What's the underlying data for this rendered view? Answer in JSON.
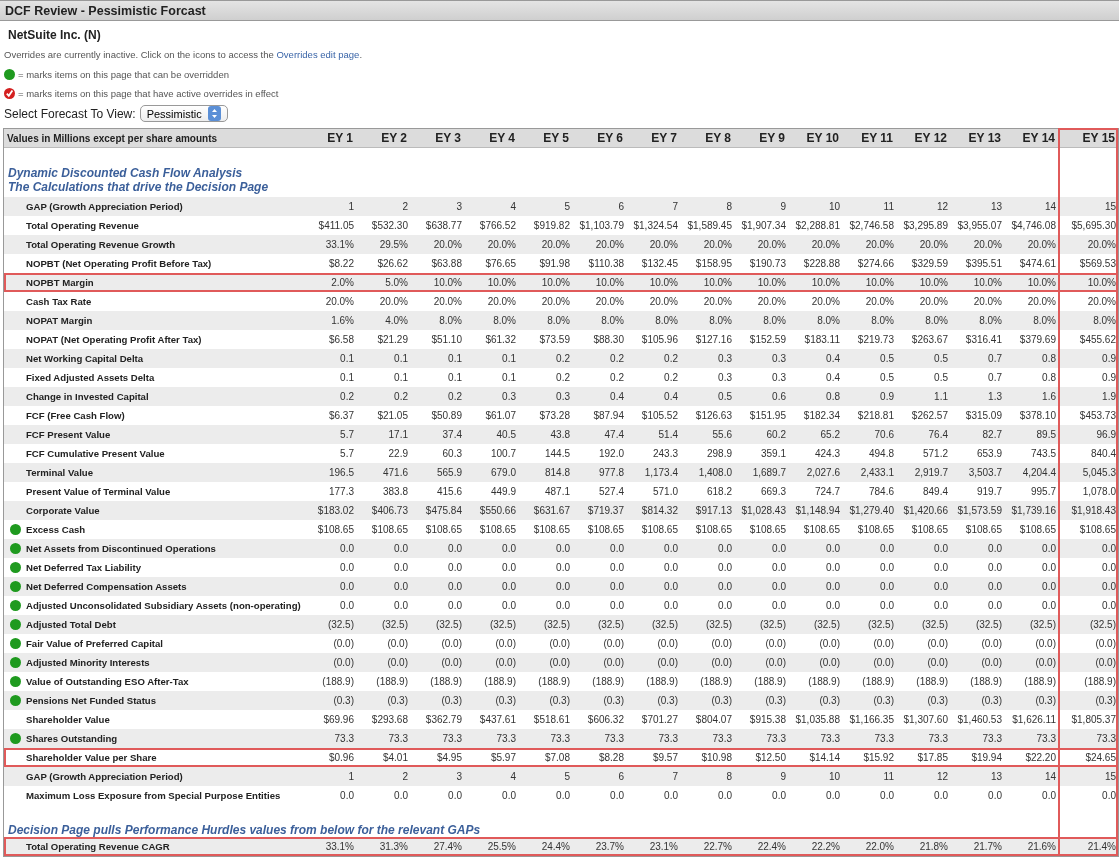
{
  "window": {
    "title": "DCF Review - Pessimistic Forcast"
  },
  "company": "NetSuite Inc. (N)",
  "intro": {
    "text": "Overrides are currently inactive. Click on the icons to access the",
    "link": "Overrides edit page",
    "after": "."
  },
  "legend": [
    {
      "kind": "overridable",
      "text": "= marks items on this page that can be overridden"
    },
    {
      "kind": "active",
      "text": "= marks items on this page that have active overrides in effect"
    }
  ],
  "forecast_select": {
    "label": "Select Forecast To View:",
    "value": "Pessimistic"
  },
  "table": {
    "caption": "Values in Millions except per share amounts",
    "columns": [
      {
        "label": "EY 1",
        "highlighted": false
      },
      {
        "label": "EY 2",
        "highlighted": false
      },
      {
        "label": "EY 3",
        "highlighted": false
      },
      {
        "label": "EY 4",
        "highlighted": false
      },
      {
        "label": "EY 5",
        "highlighted": false
      },
      {
        "label": "EY 6",
        "highlighted": false
      },
      {
        "label": "EY 7",
        "highlighted": false
      },
      {
        "label": "EY 8",
        "highlighted": false
      },
      {
        "label": "EY 9",
        "highlighted": false
      },
      {
        "label": "EY 10",
        "highlighted": false
      },
      {
        "label": "EY 11",
        "highlighted": false
      },
      {
        "label": "EY 12",
        "highlighted": false
      },
      {
        "label": "EY 13",
        "highlighted": false
      },
      {
        "label": "EY 14",
        "highlighted": false
      },
      {
        "label": "EY 15",
        "highlighted": true
      }
    ],
    "section_headings": [
      "Dynamic Discounted Cash Flow Analysis",
      "The Calculations that drive the Decision Page"
    ],
    "rows": [
      {
        "label": "GAP (Growth Appreciation Period)",
        "overridable": false,
        "highlighted": false,
        "values": [
          "1",
          "2",
          "3",
          "4",
          "5",
          "6",
          "7",
          "8",
          "9",
          "10",
          "11",
          "12",
          "13",
          "14",
          "15"
        ]
      },
      {
        "label": "Total Operating Revenue",
        "overridable": false,
        "highlighted": false,
        "values": [
          "$411.05",
          "$532.30",
          "$638.77",
          "$766.52",
          "$919.82",
          "$1,103.79",
          "$1,324.54",
          "$1,589.45",
          "$1,907.34",
          "$2,288.81",
          "$2,746.58",
          "$3,295.89",
          "$3,955.07",
          "$4,746.08",
          "$5,695.30"
        ]
      },
      {
        "label": "Total Operating Revenue Growth",
        "overridable": false,
        "highlighted": false,
        "values": [
          "33.1%",
          "29.5%",
          "20.0%",
          "20.0%",
          "20.0%",
          "20.0%",
          "20.0%",
          "20.0%",
          "20.0%",
          "20.0%",
          "20.0%",
          "20.0%",
          "20.0%",
          "20.0%",
          "20.0%"
        ]
      },
      {
        "label": "NOPBT (Net Operating Profit Before Tax)",
        "overridable": false,
        "highlighted": false,
        "values": [
          "$8.22",
          "$26.62",
          "$63.88",
          "$76.65",
          "$91.98",
          "$110.38",
          "$132.45",
          "$158.95",
          "$190.73",
          "$228.88",
          "$274.66",
          "$329.59",
          "$395.51",
          "$474.61",
          "$569.53"
        ]
      },
      {
        "label": "NOPBT Margin",
        "overridable": false,
        "highlighted": true,
        "values": [
          "2.0%",
          "5.0%",
          "10.0%",
          "10.0%",
          "10.0%",
          "10.0%",
          "10.0%",
          "10.0%",
          "10.0%",
          "10.0%",
          "10.0%",
          "10.0%",
          "10.0%",
          "10.0%",
          "10.0%"
        ]
      },
      {
        "label": "Cash Tax Rate",
        "overridable": false,
        "highlighted": false,
        "values": [
          "20.0%",
          "20.0%",
          "20.0%",
          "20.0%",
          "20.0%",
          "20.0%",
          "20.0%",
          "20.0%",
          "20.0%",
          "20.0%",
          "20.0%",
          "20.0%",
          "20.0%",
          "20.0%",
          "20.0%"
        ]
      },
      {
        "label": "NOPAT Margin",
        "overridable": false,
        "highlighted": false,
        "values": [
          "1.6%",
          "4.0%",
          "8.0%",
          "8.0%",
          "8.0%",
          "8.0%",
          "8.0%",
          "8.0%",
          "8.0%",
          "8.0%",
          "8.0%",
          "8.0%",
          "8.0%",
          "8.0%",
          "8.0%"
        ]
      },
      {
        "label": "NOPAT (Net Operating Profit After Tax)",
        "overridable": false,
        "highlighted": false,
        "values": [
          "$6.58",
          "$21.29",
          "$51.10",
          "$61.32",
          "$73.59",
          "$88.30",
          "$105.96",
          "$127.16",
          "$152.59",
          "$183.11",
          "$219.73",
          "$263.67",
          "$316.41",
          "$379.69",
          "$455.62"
        ]
      },
      {
        "label": "Net Working Capital Delta",
        "overridable": false,
        "highlighted": false,
        "values": [
          "0.1",
          "0.1",
          "0.1",
          "0.1",
          "0.2",
          "0.2",
          "0.2",
          "0.3",
          "0.3",
          "0.4",
          "0.5",
          "0.5",
          "0.7",
          "0.8",
          "0.9"
        ]
      },
      {
        "label": "Fixed Adjusted Assets Delta",
        "overridable": false,
        "highlighted": false,
        "values": [
          "0.1",
          "0.1",
          "0.1",
          "0.1",
          "0.2",
          "0.2",
          "0.2",
          "0.3",
          "0.3",
          "0.4",
          "0.5",
          "0.5",
          "0.7",
          "0.8",
          "0.9"
        ]
      },
      {
        "label": "Change in Invested Capital",
        "overridable": false,
        "highlighted": false,
        "values": [
          "0.2",
          "0.2",
          "0.2",
          "0.3",
          "0.3",
          "0.4",
          "0.4",
          "0.5",
          "0.6",
          "0.8",
          "0.9",
          "1.1",
          "1.3",
          "1.6",
          "1.9"
        ]
      },
      {
        "label": "FCF (Free Cash Flow)",
        "overridable": false,
        "highlighted": false,
        "values": [
          "$6.37",
          "$21.05",
          "$50.89",
          "$61.07",
          "$73.28",
          "$87.94",
          "$105.52",
          "$126.63",
          "$151.95",
          "$182.34",
          "$218.81",
          "$262.57",
          "$315.09",
          "$378.10",
          "$453.73"
        ]
      },
      {
        "label": "FCF Present Value",
        "overridable": false,
        "highlighted": false,
        "values": [
          "5.7",
          "17.1",
          "37.4",
          "40.5",
          "43.8",
          "47.4",
          "51.4",
          "55.6",
          "60.2",
          "65.2",
          "70.6",
          "76.4",
          "82.7",
          "89.5",
          "96.9"
        ]
      },
      {
        "label": "FCF Cumulative Present Value",
        "overridable": false,
        "highlighted": false,
        "values": [
          "5.7",
          "22.9",
          "60.3",
          "100.7",
          "144.5",
          "192.0",
          "243.3",
          "298.9",
          "359.1",
          "424.3",
          "494.8",
          "571.2",
          "653.9",
          "743.5",
          "840.4"
        ]
      },
      {
        "label": "Terminal Value",
        "overridable": false,
        "highlighted": false,
        "values": [
          "196.5",
          "471.6",
          "565.9",
          "679.0",
          "814.8",
          "977.8",
          "1,173.4",
          "1,408.0",
          "1,689.7",
          "2,027.6",
          "2,433.1",
          "2,919.7",
          "3,503.7",
          "4,204.4",
          "5,045.3"
        ]
      },
      {
        "label": "Present Value of Terminal Value",
        "overridable": false,
        "highlighted": false,
        "values": [
          "177.3",
          "383.8",
          "415.6",
          "449.9",
          "487.1",
          "527.4",
          "571.0",
          "618.2",
          "669.3",
          "724.7",
          "784.6",
          "849.4",
          "919.7",
          "995.7",
          "1,078.0"
        ]
      },
      {
        "label": "Corporate Value",
        "overridable": false,
        "highlighted": false,
        "values": [
          "$183.02",
          "$406.73",
          "$475.84",
          "$550.66",
          "$631.67",
          "$719.37",
          "$814.32",
          "$917.13",
          "$1,028.43",
          "$1,148.94",
          "$1,279.40",
          "$1,420.66",
          "$1,573.59",
          "$1,739.16",
          "$1,918.43"
        ]
      },
      {
        "label": "Excess Cash",
        "overridable": true,
        "highlighted": false,
        "values": [
          "$108.65",
          "$108.65",
          "$108.65",
          "$108.65",
          "$108.65",
          "$108.65",
          "$108.65",
          "$108.65",
          "$108.65",
          "$108.65",
          "$108.65",
          "$108.65",
          "$108.65",
          "$108.65",
          "$108.65"
        ]
      },
      {
        "label": "Net Assets from Discontinued Operations",
        "overridable": true,
        "highlighted": false,
        "values": [
          "0.0",
          "0.0",
          "0.0",
          "0.0",
          "0.0",
          "0.0",
          "0.0",
          "0.0",
          "0.0",
          "0.0",
          "0.0",
          "0.0",
          "0.0",
          "0.0",
          "0.0"
        ]
      },
      {
        "label": "Net Deferred Tax Liability",
        "overridable": true,
        "highlighted": false,
        "values": [
          "0.0",
          "0.0",
          "0.0",
          "0.0",
          "0.0",
          "0.0",
          "0.0",
          "0.0",
          "0.0",
          "0.0",
          "0.0",
          "0.0",
          "0.0",
          "0.0",
          "0.0"
        ]
      },
      {
        "label": "Net Deferred Compensation Assets",
        "overridable": true,
        "highlighted": false,
        "values": [
          "0.0",
          "0.0",
          "0.0",
          "0.0",
          "0.0",
          "0.0",
          "0.0",
          "0.0",
          "0.0",
          "0.0",
          "0.0",
          "0.0",
          "0.0",
          "0.0",
          "0.0"
        ]
      },
      {
        "label": "Adjusted Unconsolidated Subsidiary Assets (non-operating)",
        "overridable": true,
        "highlighted": false,
        "values": [
          "0.0",
          "0.0",
          "0.0",
          "0.0",
          "0.0",
          "0.0",
          "0.0",
          "0.0",
          "0.0",
          "0.0",
          "0.0",
          "0.0",
          "0.0",
          "0.0",
          "0.0"
        ]
      },
      {
        "label": "Adjusted Total Debt",
        "overridable": true,
        "highlighted": false,
        "values": [
          "(32.5)",
          "(32.5)",
          "(32.5)",
          "(32.5)",
          "(32.5)",
          "(32.5)",
          "(32.5)",
          "(32.5)",
          "(32.5)",
          "(32.5)",
          "(32.5)",
          "(32.5)",
          "(32.5)",
          "(32.5)",
          "(32.5)"
        ]
      },
      {
        "label": "Fair Value of Preferred Capital",
        "overridable": true,
        "highlighted": false,
        "values": [
          "(0.0)",
          "(0.0)",
          "(0.0)",
          "(0.0)",
          "(0.0)",
          "(0.0)",
          "(0.0)",
          "(0.0)",
          "(0.0)",
          "(0.0)",
          "(0.0)",
          "(0.0)",
          "(0.0)",
          "(0.0)",
          "(0.0)"
        ]
      },
      {
        "label": "Adjusted Minority Interests",
        "overridable": true,
        "highlighted": false,
        "values": [
          "(0.0)",
          "(0.0)",
          "(0.0)",
          "(0.0)",
          "(0.0)",
          "(0.0)",
          "(0.0)",
          "(0.0)",
          "(0.0)",
          "(0.0)",
          "(0.0)",
          "(0.0)",
          "(0.0)",
          "(0.0)",
          "(0.0)"
        ]
      },
      {
        "label": "Value of Outstanding ESO After-Tax",
        "overridable": true,
        "highlighted": false,
        "values": [
          "(188.9)",
          "(188.9)",
          "(188.9)",
          "(188.9)",
          "(188.9)",
          "(188.9)",
          "(188.9)",
          "(188.9)",
          "(188.9)",
          "(188.9)",
          "(188.9)",
          "(188.9)",
          "(188.9)",
          "(188.9)",
          "(188.9)"
        ]
      },
      {
        "label": "Pensions Net Funded Status",
        "overridable": true,
        "highlighted": false,
        "values": [
          "(0.3)",
          "(0.3)",
          "(0.3)",
          "(0.3)",
          "(0.3)",
          "(0.3)",
          "(0.3)",
          "(0.3)",
          "(0.3)",
          "(0.3)",
          "(0.3)",
          "(0.3)",
          "(0.3)",
          "(0.3)",
          "(0.3)"
        ]
      },
      {
        "label": "Shareholder Value",
        "overridable": false,
        "highlighted": false,
        "values": [
          "$69.96",
          "$293.68",
          "$362.79",
          "$437.61",
          "$518.61",
          "$606.32",
          "$701.27",
          "$804.07",
          "$915.38",
          "$1,035.88",
          "$1,166.35",
          "$1,307.60",
          "$1,460.53",
          "$1,626.11",
          "$1,805.37"
        ]
      },
      {
        "label": "Shares Outstanding",
        "overridable": true,
        "highlighted": false,
        "values": [
          "73.3",
          "73.3",
          "73.3",
          "73.3",
          "73.3",
          "73.3",
          "73.3",
          "73.3",
          "73.3",
          "73.3",
          "73.3",
          "73.3",
          "73.3",
          "73.3",
          "73.3"
        ]
      },
      {
        "label": "Shareholder Value per Share",
        "overridable": false,
        "highlighted": true,
        "values": [
          "$0.96",
          "$4.01",
          "$4.95",
          "$5.97",
          "$7.08",
          "$8.28",
          "$9.57",
          "$10.98",
          "$12.50",
          "$14.14",
          "$15.92",
          "$17.85",
          "$19.94",
          "$22.20",
          "$24.65"
        ]
      },
      {
        "label": "GAP (Growth Appreciation Period)",
        "overridable": false,
        "highlighted": false,
        "values": [
          "1",
          "2",
          "3",
          "4",
          "5",
          "6",
          "7",
          "8",
          "9",
          "10",
          "11",
          "12",
          "13",
          "14",
          "15"
        ]
      },
      {
        "label": "Maximum Loss Exposure from Special Purpose Entities",
        "overridable": false,
        "highlighted": false,
        "values": [
          "0.0",
          "0.0",
          "0.0",
          "0.0",
          "0.0",
          "0.0",
          "0.0",
          "0.0",
          "0.0",
          "0.0",
          "0.0",
          "0.0",
          "0.0",
          "0.0",
          "0.0"
        ]
      }
    ],
    "hurdles_heading": "Decision Page pulls Performance Hurdles values from below for the relevant GAPs",
    "hurdle_rows": [
      {
        "label": "Total Operating Revenue CAGR",
        "overridable": false,
        "highlighted": true,
        "values": [
          "33.1%",
          "31.3%",
          "27.4%",
          "25.5%",
          "24.4%",
          "23.7%",
          "23.1%",
          "22.7%",
          "22.4%",
          "22.2%",
          "22.0%",
          "21.8%",
          "21.7%",
          "21.6%",
          "21.4%"
        ]
      }
    ]
  }
}
